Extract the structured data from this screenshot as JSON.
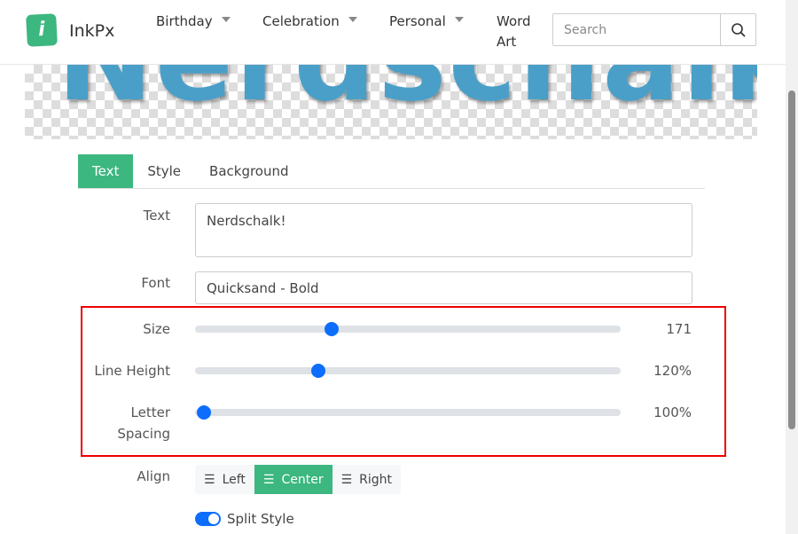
{
  "header": {
    "brand": "InkPx",
    "logo_letter": "i",
    "nav": [
      {
        "label": "Birthday",
        "has_caret": true
      },
      {
        "label": "Celebration",
        "has_caret": true
      },
      {
        "label": "Personal",
        "has_caret": true
      },
      {
        "label": "Word Art",
        "has_caret": false
      }
    ],
    "search_placeholder": "Search",
    "search_icon": "search-icon"
  },
  "preview": {
    "text": "Nerdschalk!"
  },
  "tabs": [
    {
      "label": "Text",
      "active": true
    },
    {
      "label": "Style"
    },
    {
      "label": "Background"
    }
  ],
  "form": {
    "text_label": "Text",
    "text_value": "Nerdschalk!",
    "font_label": "Font",
    "font_value": "Quicksand - Bold",
    "sliders": [
      {
        "label": "Size",
        "value": "171",
        "position": 0.32
      },
      {
        "label": "Line Height",
        "value": "120%",
        "position": 0.29
      },
      {
        "label": "Letter Spacing",
        "value": "100%",
        "position": 0.02
      }
    ],
    "align_label": "Align",
    "align_options": [
      {
        "label": "Left",
        "icon": "align-left-icon"
      },
      {
        "label": "Center",
        "icon": "align-center-icon",
        "active": true
      },
      {
        "label": "Right",
        "icon": "align-right-icon"
      }
    ],
    "split_style_label": "Split Style",
    "split_style_on": true
  },
  "colors": {
    "accent": "#3cb77f",
    "slider": "#0d6efd",
    "highlight": "#e00000"
  }
}
